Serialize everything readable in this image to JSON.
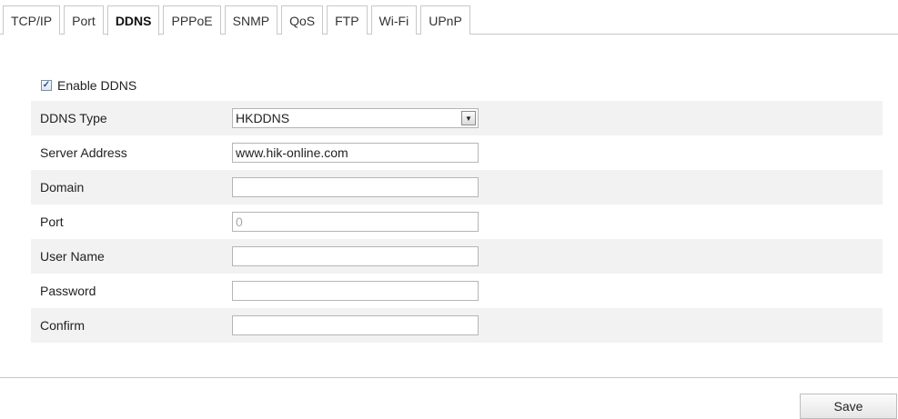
{
  "tabs": [
    {
      "label": "TCP/IP"
    },
    {
      "label": "Port"
    },
    {
      "label": "DDNS",
      "active": true
    },
    {
      "label": "PPPoE"
    },
    {
      "label": "SNMP"
    },
    {
      "label": "QoS"
    },
    {
      "label": "FTP"
    },
    {
      "label": "Wi-Fi"
    },
    {
      "label": "UPnP"
    }
  ],
  "enable_ddns": {
    "label": "Enable DDNS",
    "checked": true,
    "check_glyph": "✓"
  },
  "form": {
    "ddns_type": {
      "label": "DDNS Type",
      "value": "HKDDNS",
      "arrow_glyph": "▼"
    },
    "server_address": {
      "label": "Server Address",
      "value": "www.hik-online.com"
    },
    "domain": {
      "label": "Domain",
      "value": ""
    },
    "port": {
      "label": "Port",
      "value": "0"
    },
    "user_name": {
      "label": "User Name",
      "value": ""
    },
    "password": {
      "label": "Password",
      "value": ""
    },
    "confirm": {
      "label": "Confirm",
      "value": ""
    }
  },
  "save_label": "Save"
}
